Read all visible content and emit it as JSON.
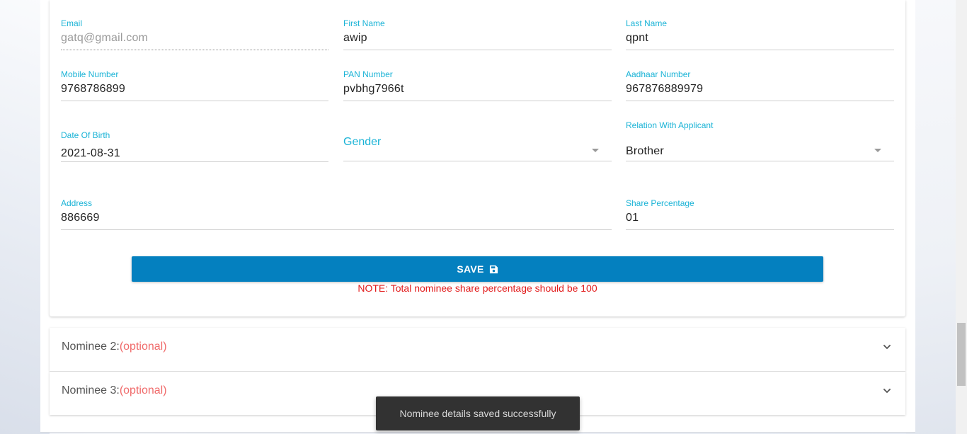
{
  "form": {
    "email": {
      "label": "Email",
      "value": "gatq@gmail.com"
    },
    "first_name": {
      "label": "First Name",
      "value": "awip"
    },
    "last_name": {
      "label": "Last Name",
      "value": "qpnt"
    },
    "mobile": {
      "label": "Mobile Number",
      "value": "9768786899"
    },
    "pan": {
      "label": "PAN Number",
      "value": "pvbhg7966t"
    },
    "aadhaar": {
      "label": "Aadhaar Number",
      "value": "967876889979"
    },
    "dob": {
      "label": "Date Of Birth",
      "value": "2021-08-31"
    },
    "gender": {
      "label": "Gender",
      "value": ""
    },
    "relation": {
      "label": "Relation With Applicant",
      "value": "Brother"
    },
    "address": {
      "label": "Address",
      "value": "886669"
    },
    "share": {
      "label": "Share Percentage",
      "value": "01"
    }
  },
  "save_button": {
    "label": "SAVE"
  },
  "note": "NOTE: Total nominee share percentage should be 100",
  "panels": [
    {
      "title": "Nominee 2:",
      "optional": "(optional)"
    },
    {
      "title": "Nominee 3:",
      "optional": "(optional)"
    }
  ],
  "toast": "Nominee details saved successfully",
  "colors": {
    "accent": "#1ab3d6",
    "button": "#0480bf",
    "error": "#e21b1b",
    "optional": "#f06a6a"
  },
  "icons": {
    "save": "floppy-disk-icon",
    "expand": "chevron-down-icon"
  }
}
